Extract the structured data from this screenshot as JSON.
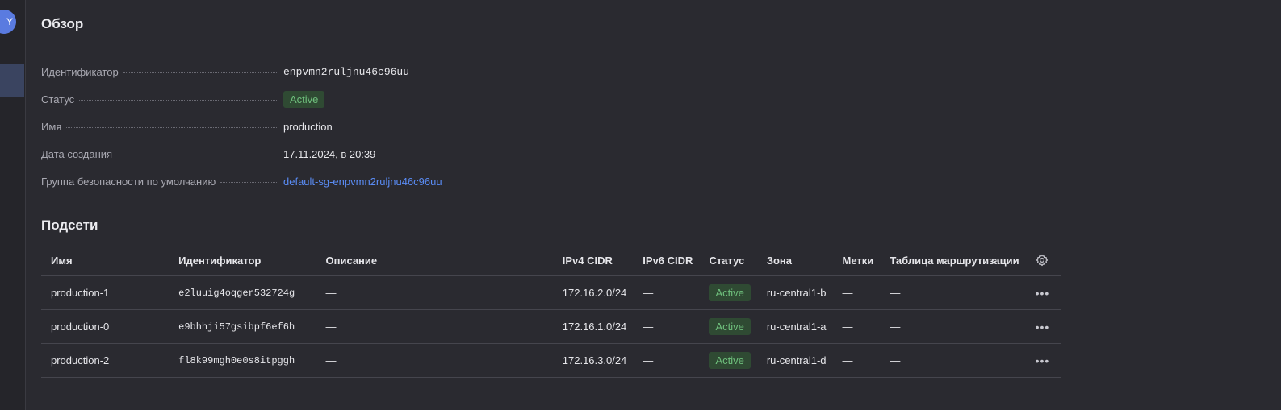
{
  "sidebar": {
    "avatar_char": "Y"
  },
  "overview": {
    "title": "Обзор",
    "rows": [
      {
        "label": "Идентификатор",
        "value": "enpvmn2ruljnu46c96uu"
      },
      {
        "label": "Статус",
        "value": "Active"
      },
      {
        "label": "Имя",
        "value": "production"
      },
      {
        "label": "Дата создания",
        "value": "17.11.2024, в 20:39"
      },
      {
        "label": "Группа безопасности по умолчанию",
        "value": "default-sg-enpvmn2ruljnu46c96uu"
      }
    ]
  },
  "subnets": {
    "title": "Подсети",
    "columns": [
      "Имя",
      "Идентификатор",
      "Описание",
      "IPv4 CIDR",
      "IPv6 CIDR",
      "Статус",
      "Зона",
      "Метки",
      "Таблица маршрутизации"
    ],
    "rows": [
      {
        "name": "production-1",
        "id": "e2luuig4oqger532724g",
        "description": "—",
        "ipv4": "172.16.2.0/24",
        "ipv6": "—",
        "status": "Active",
        "zone": "ru-central1-b",
        "labels": "—",
        "route_table": "—"
      },
      {
        "name": "production-0",
        "id": "e9bhhji57gsibpf6ef6h",
        "description": "—",
        "ipv4": "172.16.1.0/24",
        "ipv6": "—",
        "status": "Active",
        "zone": "ru-central1-a",
        "labels": "—",
        "route_table": "—"
      },
      {
        "name": "production-2",
        "id": "fl8k99mgh0e0s8itpggh",
        "description": "—",
        "ipv4": "172.16.3.0/24",
        "ipv6": "—",
        "status": "Active",
        "zone": "ru-central1-d",
        "labels": "—",
        "route_table": "—"
      }
    ],
    "row_menu_label": "•••"
  },
  "colors": {
    "accent": "#5a8cf5",
    "status_active_bg": "#2f4a33",
    "status_active_fg": "#6fc07d"
  }
}
